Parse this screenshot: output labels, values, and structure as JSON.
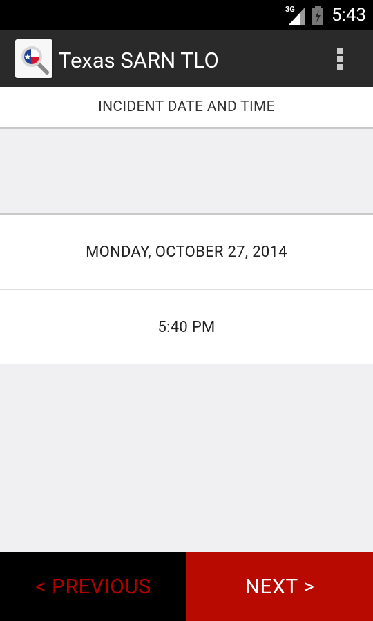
{
  "status": {
    "network": "3G",
    "time": "5:43"
  },
  "appbar": {
    "title": "Texas SARN TLO",
    "icon": "texas-flag-search-icon",
    "menu_icon": "overflow-menu-icon"
  },
  "section": {
    "header": "INCIDENT DATE AND TIME"
  },
  "fields": {
    "date": "MONDAY, OCTOBER 27, 2014",
    "time": "5:40 PM"
  },
  "nav": {
    "previous": "< PREVIOUS",
    "next": "NEXT >"
  },
  "colors": {
    "accent_red": "#b80a00",
    "previous_text": "#b00000",
    "background": "#f0f0f3"
  }
}
